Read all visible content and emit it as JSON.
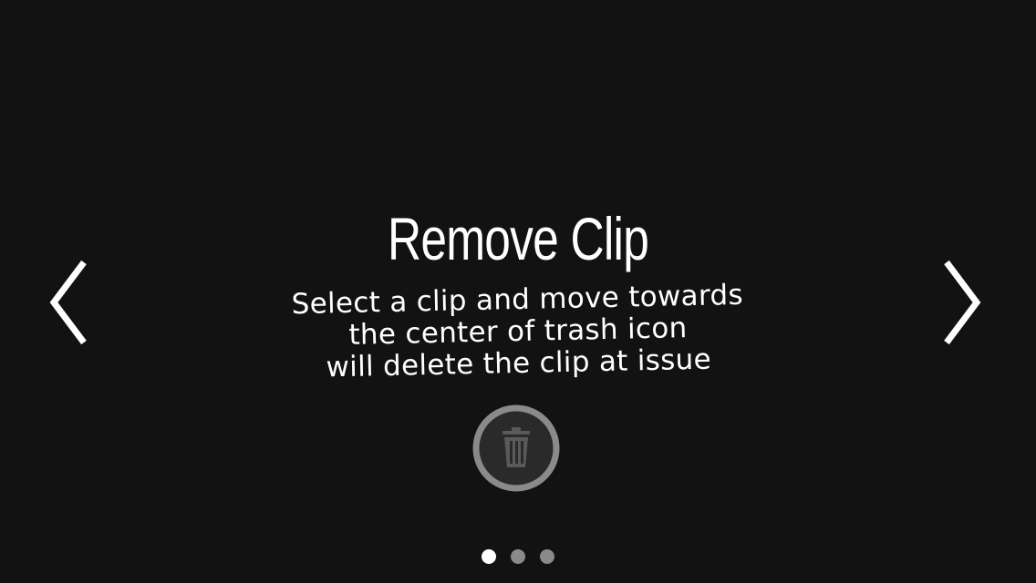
{
  "tutorial": {
    "title": "Remove Clip",
    "description_lines": [
      "Select a clip and move towards",
      "the center of trash icon",
      "will delete the clip at issue"
    ]
  },
  "navigation": {
    "prev_icon": "chevron-left-icon",
    "next_icon": "chevron-right-icon"
  },
  "trash": {
    "icon": "trash-icon"
  },
  "pager": {
    "page_count": 3,
    "current_page": 1
  },
  "colors": {
    "background": "#121212",
    "text": "#ffffff",
    "trash_ring": "#8a8a8a",
    "trash_fill": "#2a2a2a",
    "trash_glyph": "#5a5a5a",
    "dot_active": "#ffffff",
    "dot_inactive": "#8a8a8a"
  }
}
